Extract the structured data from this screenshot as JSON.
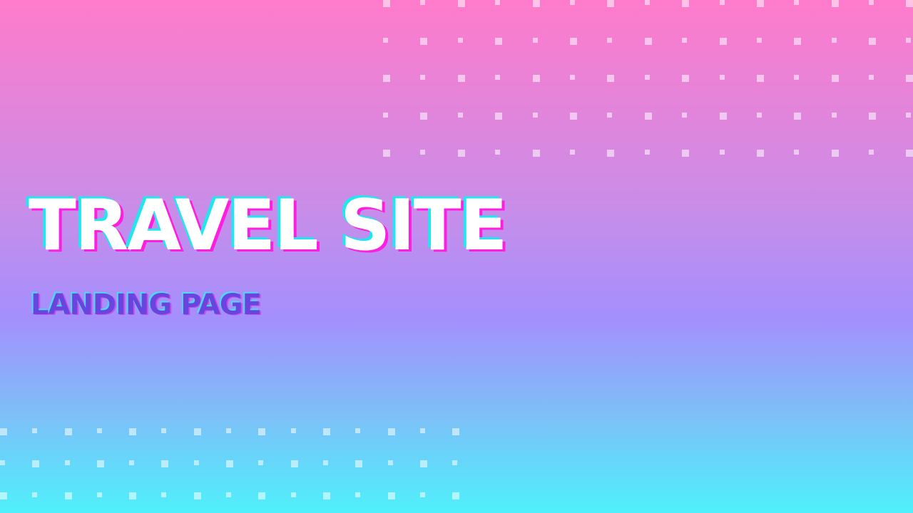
{
  "hero": {
    "title": "TRAVEL SITE",
    "subtitle": "LANDING PAGE"
  },
  "colors": {
    "gradient_top": "#ff7bcb",
    "gradient_mid": "#a48ffd",
    "gradient_bottom": "#4ff0fb",
    "title_color": "#ffffff",
    "title_shadow_cyan": "#22e5ee",
    "title_shadow_magenta": "#ff1de0",
    "subtitle_color": "#6a44df"
  },
  "decorations": {
    "top_dot_grid": "dot-pattern",
    "bottom_dot_grid": "dot-pattern"
  }
}
